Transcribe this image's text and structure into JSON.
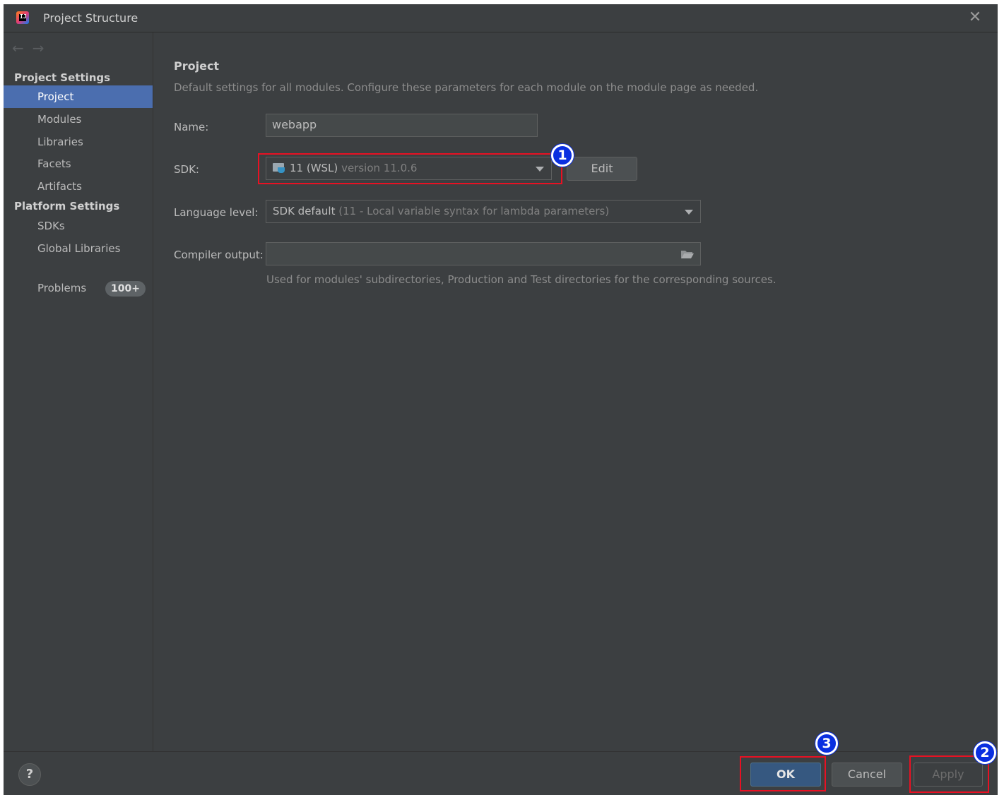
{
  "window": {
    "title": "Project Structure"
  },
  "sidebar": {
    "project_settings_header": "Project Settings",
    "project_items": [
      "Project",
      "Modules",
      "Libraries",
      "Facets",
      "Artifacts"
    ],
    "platform_settings_header": "Platform Settings",
    "platform_items": [
      "SDKs",
      "Global Libraries"
    ],
    "problems_label": "Problems",
    "problems_count": "100+"
  },
  "main": {
    "title": "Project",
    "description": "Default settings for all modules. Configure these parameters for each module on the module page as needed.",
    "name_label": "Name:",
    "name_value": "webapp",
    "sdk_label": "SDK:",
    "sdk_value": "11 (WSL)",
    "sdk_version": "version 11.0.6",
    "sdk_edit_label": "Edit",
    "language_label": "Language level:",
    "language_value": "SDK default",
    "language_detail": "(11 - Local variable syntax for lambda parameters)",
    "compiler_label": "Compiler output:",
    "compiler_value": "",
    "compiler_hint": "Used for modules' subdirectories, Production and Test directories for the corresponding sources."
  },
  "footer": {
    "help_label": "?",
    "ok_label": "OK",
    "cancel_label": "Cancel",
    "apply_label": "Apply"
  },
  "annotations": {
    "marker1": "1",
    "marker2": "2",
    "marker3": "3"
  },
  "colors": {
    "selection": "#4b6eaf",
    "annotation_red": "#e81123",
    "annotation_blue": "#0a2fe0",
    "primary_button": "#365880"
  }
}
